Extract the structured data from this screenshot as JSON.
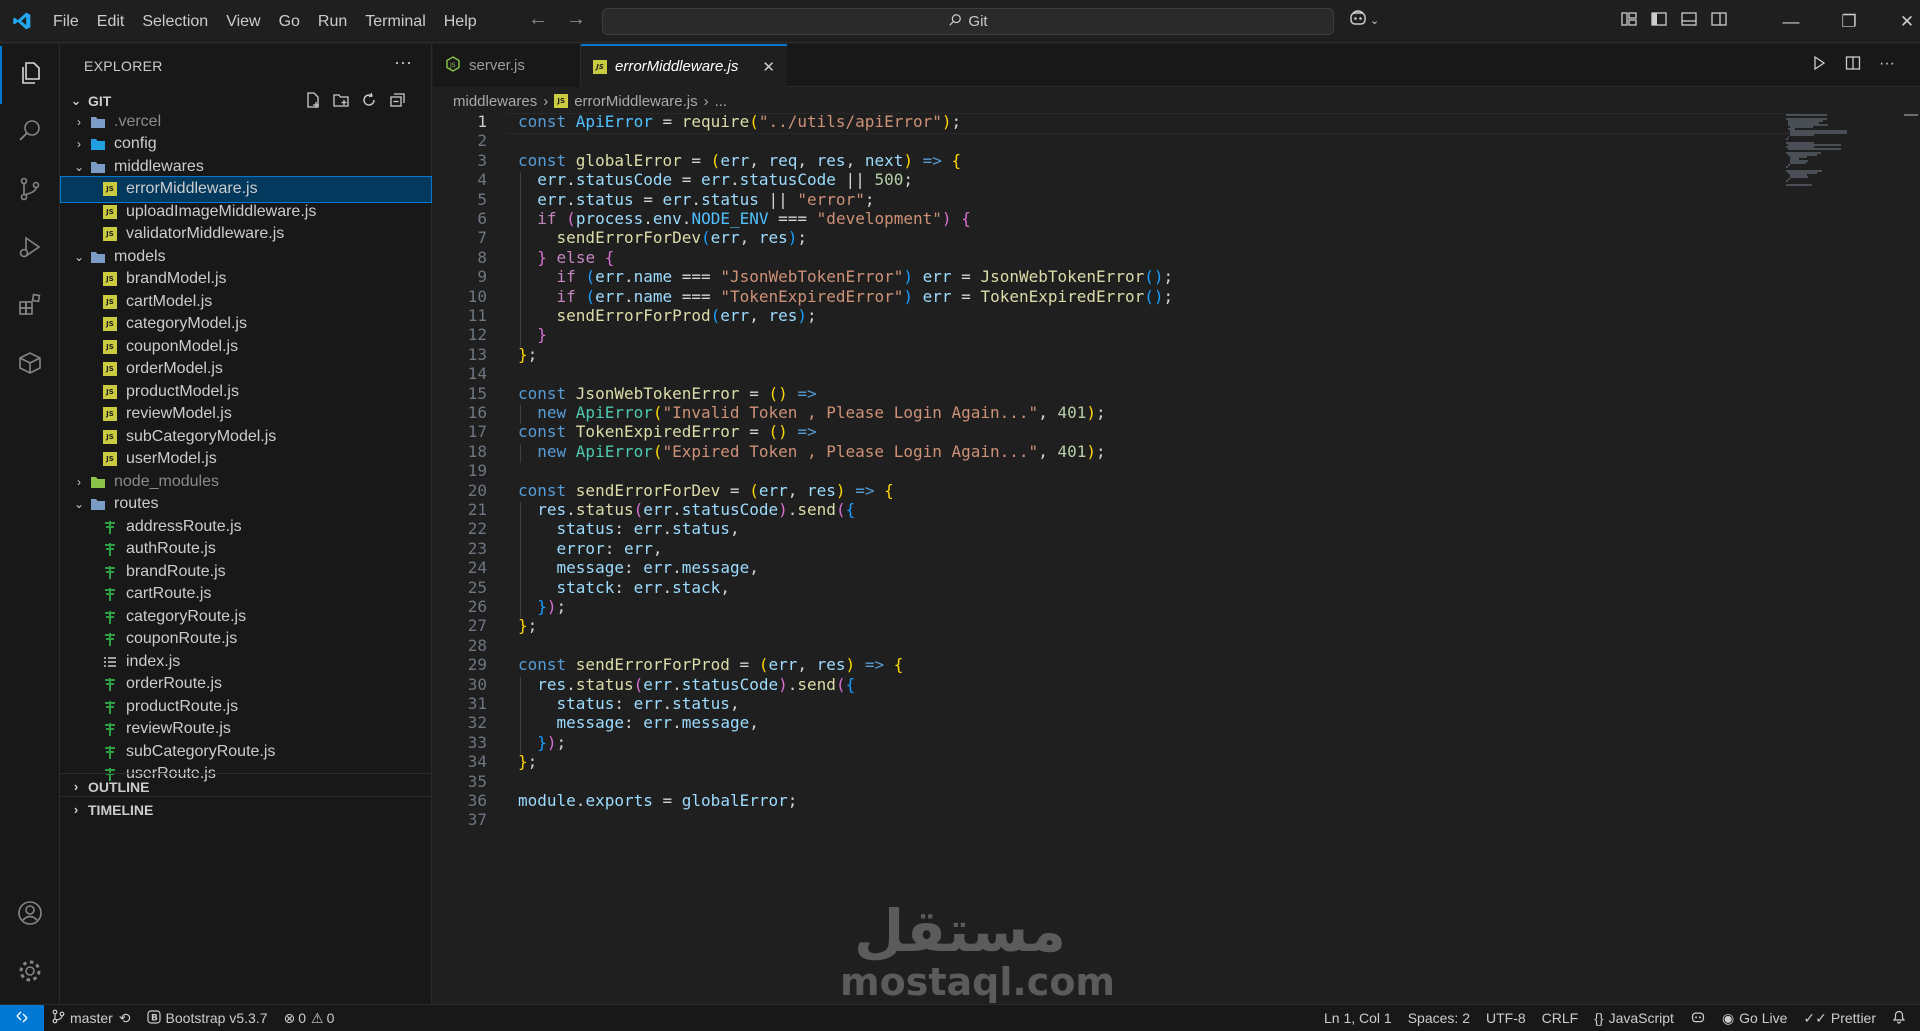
{
  "menu": [
    "File",
    "Edit",
    "Selection",
    "View",
    "Go",
    "Run",
    "Terminal",
    "Help"
  ],
  "search": {
    "label": "Git"
  },
  "window_controls": {
    "minimize": "—",
    "restore": "❐",
    "close": "✕"
  },
  "sidebar": {
    "title": "EXPLORER",
    "more": "···",
    "section": "GIT",
    "outline": "OUTLINE",
    "timeline": "TIMELINE"
  },
  "tree": [
    {
      "label": ".vercel",
      "type": "folder",
      "open": false,
      "depth": 0,
      "dim": true
    },
    {
      "label": "config",
      "type": "folder",
      "open": false,
      "depth": 0
    },
    {
      "label": "middlewares",
      "type": "folder",
      "open": true,
      "depth": 0
    },
    {
      "label": "errorMiddleware.js",
      "type": "js",
      "depth": 1,
      "selected": true
    },
    {
      "label": "uploadImageMiddleware.js",
      "type": "js",
      "depth": 1
    },
    {
      "label": "validatorMiddleware.js",
      "type": "js",
      "depth": 1
    },
    {
      "label": "models",
      "type": "folder",
      "open": true,
      "depth": 0
    },
    {
      "label": "brandModel.js",
      "type": "js",
      "depth": 1
    },
    {
      "label": "cartModel.js",
      "type": "js",
      "depth": 1
    },
    {
      "label": "categoryModel.js",
      "type": "js",
      "depth": 1
    },
    {
      "label": "couponModel.js",
      "type": "js",
      "depth": 1
    },
    {
      "label": "orderModel.js",
      "type": "js",
      "depth": 1
    },
    {
      "label": "productModel.js",
      "type": "js",
      "depth": 1
    },
    {
      "label": "reviewModel.js",
      "type": "js",
      "depth": 1
    },
    {
      "label": "subCategoryModel.js",
      "type": "js",
      "depth": 1
    },
    {
      "label": "userModel.js",
      "type": "js",
      "depth": 1
    },
    {
      "label": "node_modules",
      "type": "folder",
      "open": false,
      "depth": 0,
      "dim": true
    },
    {
      "label": "routes",
      "type": "folder",
      "open": true,
      "depth": 0
    },
    {
      "label": "addressRoute.js",
      "type": "route",
      "depth": 1
    },
    {
      "label": "authRoute.js",
      "type": "route",
      "depth": 1
    },
    {
      "label": "brandRoute.js",
      "type": "route",
      "depth": 1
    },
    {
      "label": "cartRoute.js",
      "type": "route",
      "depth": 1
    },
    {
      "label": "categoryRoute.js",
      "type": "route",
      "depth": 1
    },
    {
      "label": "couponRoute.js",
      "type": "route",
      "depth": 1
    },
    {
      "label": "index.js",
      "type": "index",
      "depth": 1
    },
    {
      "label": "orderRoute.js",
      "type": "route",
      "depth": 1
    },
    {
      "label": "productRoute.js",
      "type": "route",
      "depth": 1
    },
    {
      "label": "reviewRoute.js",
      "type": "route",
      "depth": 1
    },
    {
      "label": "subCategoryRoute.js",
      "type": "route",
      "depth": 1
    },
    {
      "label": "userRoute.js",
      "type": "route",
      "depth": 1
    }
  ],
  "tabs": [
    {
      "label": "server.js",
      "active": false,
      "icon": "nodejs-icon"
    },
    {
      "label": "errorMiddleware.js",
      "active": true,
      "icon": "js-icon"
    }
  ],
  "breadcrumb": {
    "folder": "middlewares",
    "file": "errorMiddleware.js",
    "more": "..."
  },
  "code": [
    [
      [
        "k",
        "const "
      ],
      [
        "c",
        "ApiError"
      ],
      [
        "p",
        " = "
      ],
      [
        "f",
        "require"
      ],
      [
        "b1",
        "("
      ],
      [
        "s",
        "\"../utils/apiError\""
      ],
      [
        "b1",
        ")"
      ],
      [
        "p",
        ";"
      ]
    ],
    [],
    [
      [
        "k",
        "const "
      ],
      [
        "f",
        "globalError"
      ],
      [
        "p",
        " = "
      ],
      [
        "b1",
        "("
      ],
      [
        "v",
        "err"
      ],
      [
        "p",
        ", "
      ],
      [
        "v",
        "req"
      ],
      [
        "p",
        ", "
      ],
      [
        "v",
        "res"
      ],
      [
        "p",
        ", "
      ],
      [
        "v",
        "next"
      ],
      [
        "b1",
        ")"
      ],
      [
        "p",
        " "
      ],
      [
        "k",
        "=>"
      ],
      [
        "p",
        " "
      ],
      [
        "b1",
        "{"
      ]
    ],
    [
      [
        "p",
        "  "
      ],
      [
        "v",
        "err"
      ],
      [
        "p",
        "."
      ],
      [
        "v",
        "statusCode"
      ],
      [
        "p",
        " = "
      ],
      [
        "v",
        "err"
      ],
      [
        "p",
        "."
      ],
      [
        "v",
        "statusCode"
      ],
      [
        "p",
        " || "
      ],
      [
        "n",
        "500"
      ],
      [
        "p",
        ";"
      ]
    ],
    [
      [
        "p",
        "  "
      ],
      [
        "v",
        "err"
      ],
      [
        "p",
        "."
      ],
      [
        "v",
        "status"
      ],
      [
        "p",
        " = "
      ],
      [
        "v",
        "err"
      ],
      [
        "p",
        "."
      ],
      [
        "v",
        "status"
      ],
      [
        "p",
        " || "
      ],
      [
        "s",
        "\"error\""
      ],
      [
        "p",
        ";"
      ]
    ],
    [
      [
        "p",
        "  "
      ],
      [
        "kc",
        "if"
      ],
      [
        "p",
        " "
      ],
      [
        "b2",
        "("
      ],
      [
        "v",
        "process"
      ],
      [
        "p",
        "."
      ],
      [
        "v",
        "env"
      ],
      [
        "p",
        "."
      ],
      [
        "c",
        "NODE_ENV"
      ],
      [
        "p",
        " === "
      ],
      [
        "s",
        "\"development\""
      ],
      [
        "b2",
        ")"
      ],
      [
        "p",
        " "
      ],
      [
        "b2",
        "{"
      ]
    ],
    [
      [
        "p",
        "    "
      ],
      [
        "f",
        "sendErrorForDev"
      ],
      [
        "b3",
        "("
      ],
      [
        "v",
        "err"
      ],
      [
        "p",
        ", "
      ],
      [
        "v",
        "res"
      ],
      [
        "b3",
        ")"
      ],
      [
        "p",
        ";"
      ]
    ],
    [
      [
        "p",
        "  "
      ],
      [
        "b2",
        "}"
      ],
      [
        "p",
        " "
      ],
      [
        "kc",
        "else"
      ],
      [
        "p",
        " "
      ],
      [
        "b2",
        "{"
      ]
    ],
    [
      [
        "p",
        "    "
      ],
      [
        "kc",
        "if"
      ],
      [
        "p",
        " "
      ],
      [
        "b3",
        "("
      ],
      [
        "v",
        "err"
      ],
      [
        "p",
        "."
      ],
      [
        "v",
        "name"
      ],
      [
        "p",
        " === "
      ],
      [
        "s",
        "\"JsonWebTokenError\""
      ],
      [
        "b3",
        ")"
      ],
      [
        "p",
        " "
      ],
      [
        "v",
        "err"
      ],
      [
        "p",
        " = "
      ],
      [
        "f",
        "JsonWebTokenError"
      ],
      [
        "b3",
        "()"
      ],
      [
        "p",
        ";"
      ]
    ],
    [
      [
        "p",
        "    "
      ],
      [
        "kc",
        "if"
      ],
      [
        "p",
        " "
      ],
      [
        "b3",
        "("
      ],
      [
        "v",
        "err"
      ],
      [
        "p",
        "."
      ],
      [
        "v",
        "name"
      ],
      [
        "p",
        " === "
      ],
      [
        "s",
        "\"TokenExpiredError\""
      ],
      [
        "b3",
        ")"
      ],
      [
        "p",
        " "
      ],
      [
        "v",
        "err"
      ],
      [
        "p",
        " = "
      ],
      [
        "f",
        "TokenExpiredError"
      ],
      [
        "b3",
        "()"
      ],
      [
        "p",
        ";"
      ]
    ],
    [
      [
        "p",
        "    "
      ],
      [
        "f",
        "sendErrorForProd"
      ],
      [
        "b3",
        "("
      ],
      [
        "v",
        "err"
      ],
      [
        "p",
        ", "
      ],
      [
        "v",
        "res"
      ],
      [
        "b3",
        ")"
      ],
      [
        "p",
        ";"
      ]
    ],
    [
      [
        "p",
        "  "
      ],
      [
        "b2",
        "}"
      ]
    ],
    [
      [
        "b1",
        "}"
      ],
      [
        "p",
        ";"
      ]
    ],
    [],
    [
      [
        "k",
        "const "
      ],
      [
        "f",
        "JsonWebTokenError"
      ],
      [
        "p",
        " = "
      ],
      [
        "b1",
        "()"
      ],
      [
        "p",
        " "
      ],
      [
        "k",
        "=>"
      ]
    ],
    [
      [
        "p",
        "  "
      ],
      [
        "k",
        "new "
      ],
      [
        "cls",
        "ApiError"
      ],
      [
        "b1",
        "("
      ],
      [
        "s",
        "\"Invalid Token , Please Login Again...\""
      ],
      [
        "p",
        ", "
      ],
      [
        "n",
        "401"
      ],
      [
        "b1",
        ")"
      ],
      [
        "p",
        ";"
      ]
    ],
    [
      [
        "k",
        "const "
      ],
      [
        "f",
        "TokenExpiredError"
      ],
      [
        "p",
        " = "
      ],
      [
        "b1",
        "()"
      ],
      [
        "p",
        " "
      ],
      [
        "k",
        "=>"
      ]
    ],
    [
      [
        "p",
        "  "
      ],
      [
        "k",
        "new "
      ],
      [
        "cls",
        "ApiError"
      ],
      [
        "b1",
        "("
      ],
      [
        "s",
        "\"Expired Token , Please Login Again...\""
      ],
      [
        "p",
        ", "
      ],
      [
        "n",
        "401"
      ],
      [
        "b1",
        ")"
      ],
      [
        "p",
        ";"
      ]
    ],
    [],
    [
      [
        "k",
        "const "
      ],
      [
        "f",
        "sendErrorForDev"
      ],
      [
        "p",
        " = "
      ],
      [
        "b1",
        "("
      ],
      [
        "v",
        "err"
      ],
      [
        "p",
        ", "
      ],
      [
        "v",
        "res"
      ],
      [
        "b1",
        ")"
      ],
      [
        "p",
        " "
      ],
      [
        "k",
        "=>"
      ],
      [
        "p",
        " "
      ],
      [
        "b1",
        "{"
      ]
    ],
    [
      [
        "p",
        "  "
      ],
      [
        "v",
        "res"
      ],
      [
        "p",
        "."
      ],
      [
        "f",
        "status"
      ],
      [
        "b2",
        "("
      ],
      [
        "v",
        "err"
      ],
      [
        "p",
        "."
      ],
      [
        "v",
        "statusCode"
      ],
      [
        "b2",
        ")"
      ],
      [
        "p",
        "."
      ],
      [
        "f",
        "send"
      ],
      [
        "b2",
        "("
      ],
      [
        "b3",
        "{"
      ]
    ],
    [
      [
        "p",
        "    "
      ],
      [
        "v",
        "status"
      ],
      [
        "p",
        ": "
      ],
      [
        "v",
        "err"
      ],
      [
        "p",
        "."
      ],
      [
        "v",
        "status"
      ],
      [
        "p",
        ","
      ]
    ],
    [
      [
        "p",
        "    "
      ],
      [
        "v",
        "error"
      ],
      [
        "p",
        ": "
      ],
      [
        "v",
        "err"
      ],
      [
        "p",
        ","
      ]
    ],
    [
      [
        "p",
        "    "
      ],
      [
        "v",
        "message"
      ],
      [
        "p",
        ": "
      ],
      [
        "v",
        "err"
      ],
      [
        "p",
        "."
      ],
      [
        "v",
        "message"
      ],
      [
        "p",
        ","
      ]
    ],
    [
      [
        "p",
        "    "
      ],
      [
        "v",
        "statck"
      ],
      [
        "p",
        ": "
      ],
      [
        "v",
        "err"
      ],
      [
        "p",
        "."
      ],
      [
        "v",
        "stack"
      ],
      [
        "p",
        ","
      ]
    ],
    [
      [
        "p",
        "  "
      ],
      [
        "b3",
        "}"
      ],
      [
        "b2",
        ")"
      ],
      [
        "p",
        ";"
      ]
    ],
    [
      [
        "b1",
        "}"
      ],
      [
        "p",
        ";"
      ]
    ],
    [],
    [
      [
        "k",
        "const "
      ],
      [
        "f",
        "sendErrorForProd"
      ],
      [
        "p",
        " = "
      ],
      [
        "b1",
        "("
      ],
      [
        "v",
        "err"
      ],
      [
        "p",
        ", "
      ],
      [
        "v",
        "res"
      ],
      [
        "b1",
        ")"
      ],
      [
        "p",
        " "
      ],
      [
        "k",
        "=>"
      ],
      [
        "p",
        " "
      ],
      [
        "b1",
        "{"
      ]
    ],
    [
      [
        "p",
        "  "
      ],
      [
        "v",
        "res"
      ],
      [
        "p",
        "."
      ],
      [
        "f",
        "status"
      ],
      [
        "b2",
        "("
      ],
      [
        "v",
        "err"
      ],
      [
        "p",
        "."
      ],
      [
        "v",
        "statusCode"
      ],
      [
        "b2",
        ")"
      ],
      [
        "p",
        "."
      ],
      [
        "f",
        "send"
      ],
      [
        "b2",
        "("
      ],
      [
        "b3",
        "{"
      ]
    ],
    [
      [
        "p",
        "    "
      ],
      [
        "v",
        "status"
      ],
      [
        "p",
        ": "
      ],
      [
        "v",
        "err"
      ],
      [
        "p",
        "."
      ],
      [
        "v",
        "status"
      ],
      [
        "p",
        ","
      ]
    ],
    [
      [
        "p",
        "    "
      ],
      [
        "v",
        "message"
      ],
      [
        "p",
        ": "
      ],
      [
        "v",
        "err"
      ],
      [
        "p",
        "."
      ],
      [
        "v",
        "message"
      ],
      [
        "p",
        ","
      ]
    ],
    [
      [
        "p",
        "  "
      ],
      [
        "b3",
        "}"
      ],
      [
        "b2",
        ")"
      ],
      [
        "p",
        ";"
      ]
    ],
    [
      [
        "b1",
        "}"
      ],
      [
        "p",
        ";"
      ]
    ],
    [],
    [
      [
        "v",
        "module"
      ],
      [
        "p",
        "."
      ],
      [
        "v",
        "exports"
      ],
      [
        "p",
        " = "
      ],
      [
        "v",
        "globalError"
      ],
      [
        "p",
        ";"
      ]
    ],
    []
  ],
  "watermark": {
    "arabic": "مستقل",
    "latin": "mostaql.com"
  },
  "status": {
    "branch": "master",
    "bootstrap": "Bootstrap v5.3.7",
    "errors": "0",
    "warnings": "0",
    "position": "Ln 1, Col 1",
    "spaces": "Spaces: 2",
    "encoding": "UTF-8",
    "eol": "CRLF",
    "language": "JavaScript",
    "golive": "Go Live",
    "prettier": "Prettier"
  },
  "colors": {
    "accent": "#0078d4",
    "background": "#1f1f1f",
    "sidebar": "#181818",
    "selection": "#04395e"
  }
}
